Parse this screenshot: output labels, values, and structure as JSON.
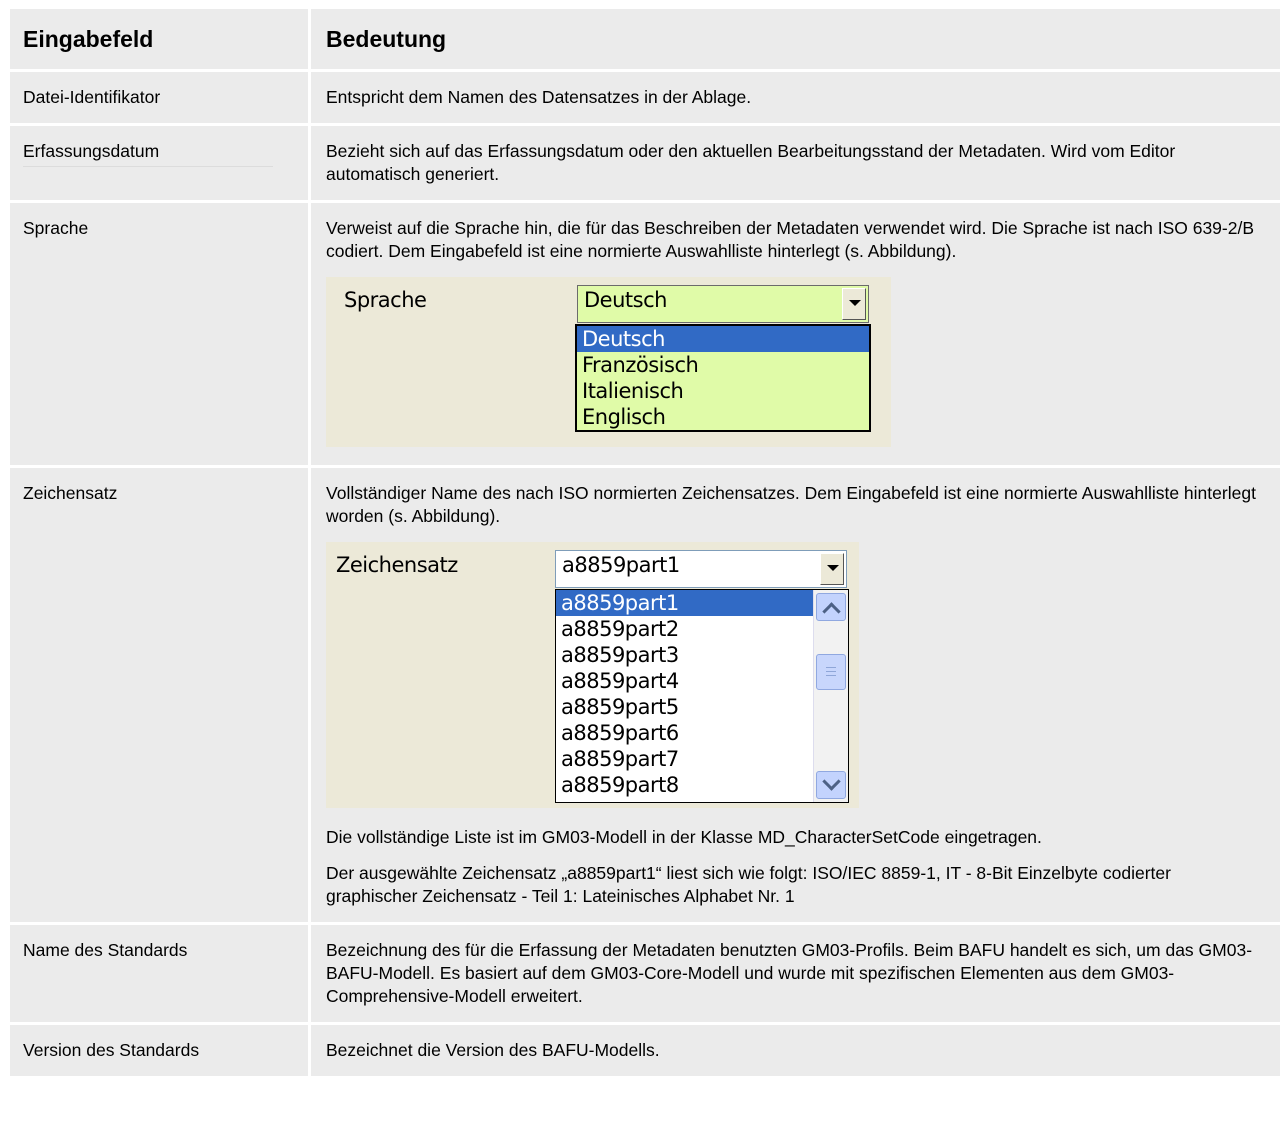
{
  "table": {
    "header": {
      "col1": "Eingabefeld",
      "col2": "Bedeutung"
    },
    "rows": [
      {
        "field": "Datei-Identifikator",
        "meaning": "Entspricht dem Namen des Datensatzes in der Ablage."
      },
      {
        "field": "Erfassungsdatum",
        "meaning": "Bezieht sich auf das Erfassungsdatum oder den aktuellen Bearbeitungsstand der Metadaten. Wird vom Editor automatisch generiert."
      },
      {
        "field": "Sprache",
        "meaning": "Verweist auf die Sprache hin, die für das Beschreiben der Metadaten verwendet wird. Die Sprache ist nach ISO 639-2/B codiert. Dem Eingabefeld ist eine normierte Auswahlliste hinterlegt (s. Abbildung)."
      },
      {
        "field": "Zeichensatz",
        "meaning": "Vollständiger Name des nach ISO normierten Zeichensatzes. Dem Eingabefeld ist eine normierte Auswahlliste hinterlegt worden (s. Abbildung).",
        "note1": "Die vollständige Liste ist im GM03-Modell in der Klasse MD_CharacterSetCode eingetragen.",
        "note2": "Der ausgewählte Zeichensatz „a8859part1“ liest sich wie folgt: ISO/IEC 8859-1, IT - 8-Bit Einzelbyte codierter graphischer Zeichensatz - Teil 1: Lateinisches Alphabet Nr. 1"
      },
      {
        "field": "Name des Standards",
        "meaning": "Bezeichnung des für die Erfassung der Metadaten benutzten GM03-Profils. Beim BAFU handelt es sich, um das GM03-BAFU-Modell. Es basiert auf dem GM03-Core-Modell und wurde mit spezifischen Elementen aus dem GM03-Comprehensive-Modell erweitert."
      },
      {
        "field": "Version des Standards",
        "meaning": "Bezeichnet die Version des BAFU-Modells."
      }
    ]
  },
  "sprache_shot": {
    "label": "Sprache",
    "selected": "Deutsch",
    "options": [
      "Deutsch",
      "Französisch",
      "Italienisch",
      "Englisch"
    ]
  },
  "zeichensatz_shot": {
    "label": "Zeichensatz",
    "selected": "a8859part1",
    "options": [
      "a8859part1",
      "a8859part2",
      "a8859part3",
      "a8859part4",
      "a8859part5",
      "a8859part6",
      "a8859part7",
      "a8859part8"
    ]
  },
  "icons": [
    "dropdown-arrow-icon",
    "scroll-up-icon",
    "scroll-down-icon"
  ],
  "colors": {
    "cell_bg": "#ebebeb",
    "dialog_bg": "#ece9d8",
    "field_green": "#e0fba8",
    "selection_blue": "#316ac5"
  }
}
